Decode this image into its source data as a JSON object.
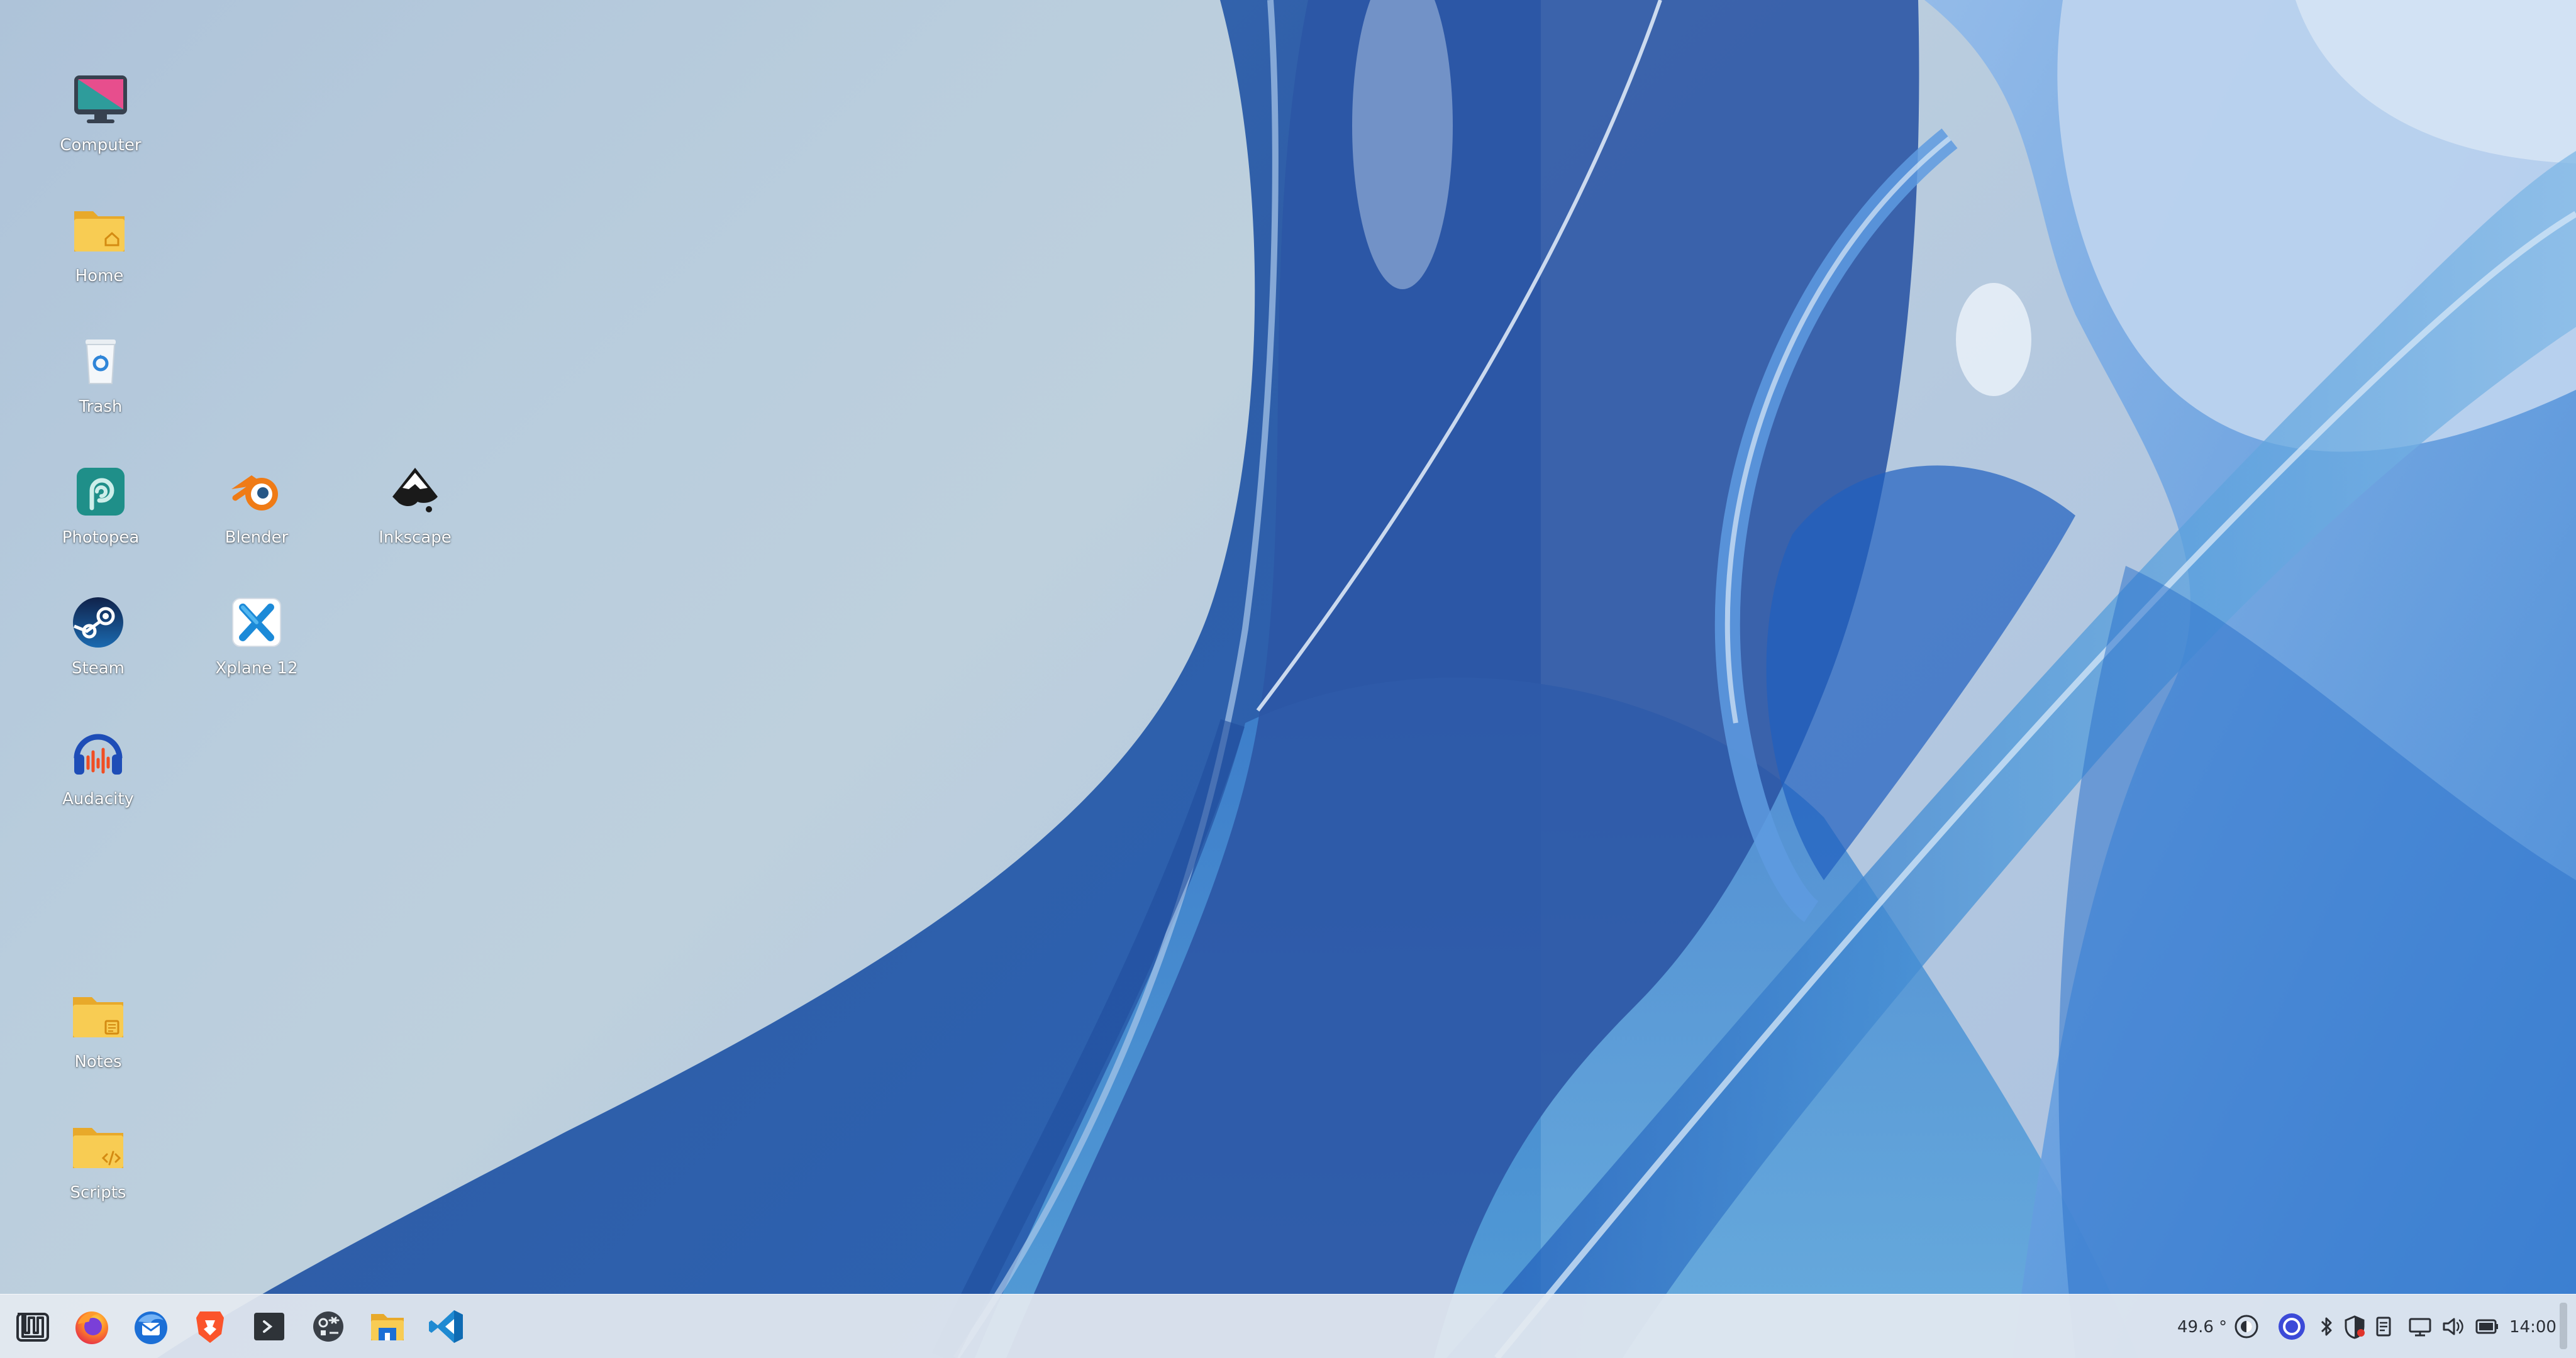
{
  "desktop": {
    "icons": [
      {
        "label": "Computer",
        "icon": "computer-icon"
      },
      {
        "label": "Home",
        "icon": "home-folder-icon"
      },
      {
        "label": "Trash",
        "icon": "trash-icon"
      },
      {
        "label": "Photopea",
        "icon": "photopea-icon"
      },
      {
        "label": "Blender",
        "icon": "blender-icon"
      },
      {
        "label": "Inkscape",
        "icon": "inkscape-icon"
      },
      {
        "label": "Steam",
        "icon": "steam-icon"
      },
      {
        "label": "Xplane 12",
        "icon": "xplane-icon"
      },
      {
        "label": "Audacity",
        "icon": "audacity-icon"
      },
      {
        "label": "Notes",
        "icon": "notes-folder-icon"
      },
      {
        "label": "Scripts",
        "icon": "scripts-folder-icon"
      }
    ]
  },
  "taskbar": {
    "apps": [
      {
        "name": "Menu",
        "icon": "mint-menu-icon"
      },
      {
        "name": "Firefox",
        "icon": "firefox-icon"
      },
      {
        "name": "Thunderbird",
        "icon": "thunderbird-icon"
      },
      {
        "name": "Brave",
        "icon": "brave-icon"
      },
      {
        "name": "Terminal",
        "icon": "terminal-icon"
      },
      {
        "name": "System Settings",
        "icon": "settings-icon"
      },
      {
        "name": "Files",
        "icon": "file-manager-icon"
      },
      {
        "name": "Visual Studio Code",
        "icon": "vscode-icon"
      }
    ],
    "tray": {
      "temperature": "49.6 °",
      "clock": "14:00",
      "icons": [
        "display-icon",
        "vpn-icon",
        "bluetooth-icon",
        "shield-icon",
        "clipboard-icon",
        "network-icon",
        "volume-icon",
        "battery-icon"
      ]
    }
  },
  "colors": {
    "taskbar_bg": "#e4eaf0",
    "wallpaper_blue": "#2f5ea8",
    "folder_yellow": "#f6c945"
  }
}
